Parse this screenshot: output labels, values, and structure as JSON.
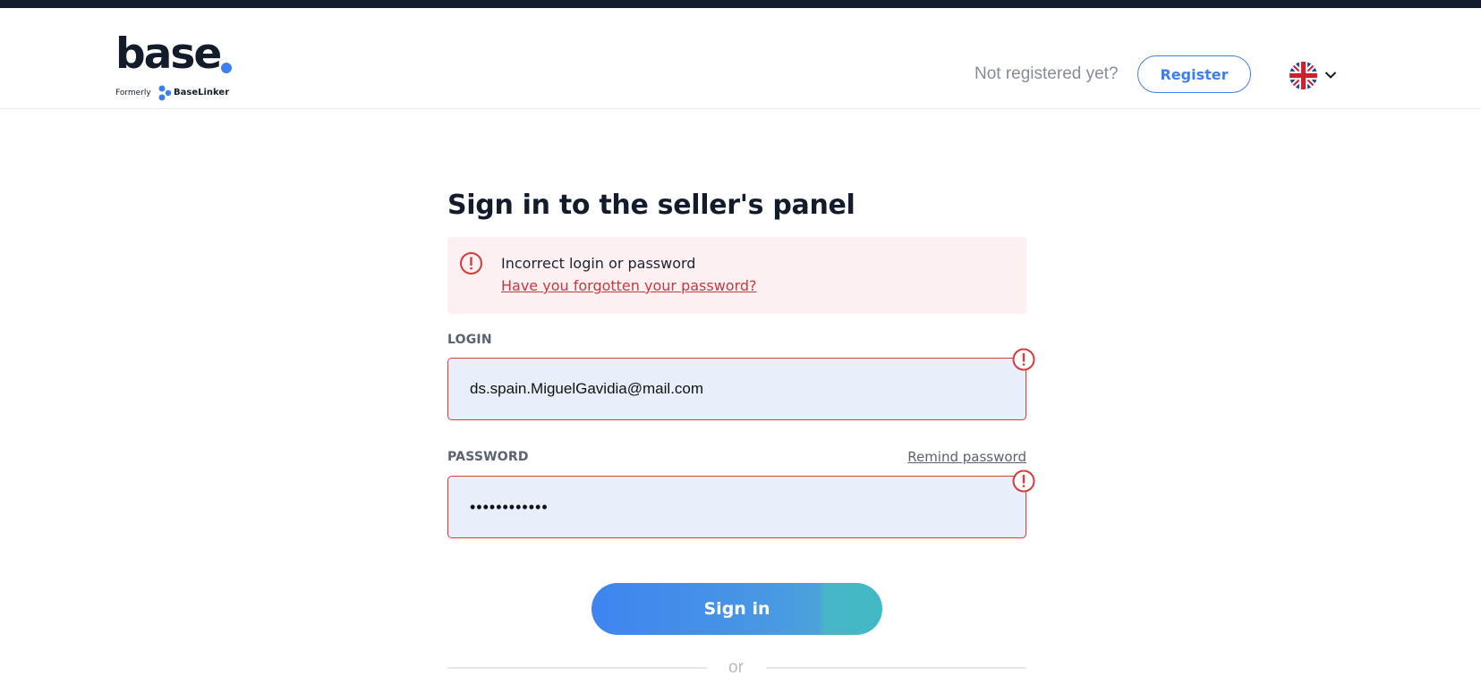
{
  "header": {
    "logo_text": "base",
    "logo_formerly": "Formerly",
    "logo_former_brand": "BaseLinker",
    "not_registered": "Not registered yet?",
    "register_label": "Register",
    "language_icon": "uk-flag-icon"
  },
  "form": {
    "title": "Sign in to the seller's panel",
    "alert": {
      "message": "Incorrect login or password",
      "link": "Have you forgotten your password?"
    },
    "login_label": "LOGIN",
    "login_value": "ds.spain.MiguelGavidia@mail.com",
    "password_label": "PASSWORD",
    "remind_label": "Remind password",
    "password_value": "••••••••••••",
    "signin_label": "Sign in",
    "or_label": "or"
  },
  "colors": {
    "accent": "#3d7ff0",
    "error": "#d63b3b",
    "error_bg": "#fdf0f0",
    "input_bg": "#e8effb",
    "topbar": "#131c2b"
  }
}
